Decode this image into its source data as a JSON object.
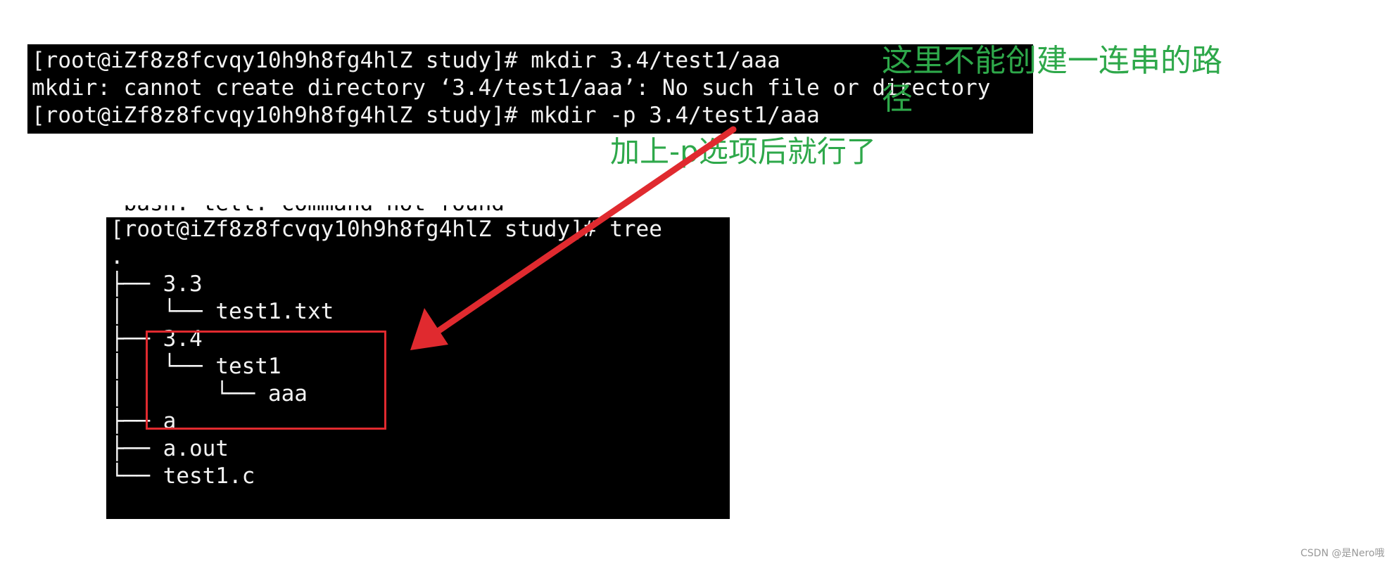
{
  "terminal_top": {
    "lines": [
      "[root@iZf8z8fcvqy10h9h8fg4hlZ study]# mkdir 3.4/test1/aaa",
      "mkdir: cannot create directory ‘3.4/test1/aaa’: No such file or directory",
      "[root@iZf8z8fcvqy10h9h8fg4hlZ study]# mkdir -p 3.4/test1/aaa"
    ]
  },
  "terminal_bottom": {
    "cut_line": "-bash: tell: command not found",
    "lines": [
      "[root@iZf8z8fcvqy10h9h8fg4hlZ study]# tree",
      ".",
      "├── 3.3",
      "│   └── test1.txt",
      "├── 3.4",
      "│   └── test1",
      "│       └── aaa",
      "├── a",
      "├── a.out",
      "└── test1.c"
    ]
  },
  "annotations": {
    "note1_line1": "这里不能创建一连串的路",
    "note1_line2": "径",
    "note2": "加上-p选项后就行了",
    "note_color": "#2ea84a",
    "highlight_color": "#e02a2f"
  },
  "watermark": "CSDN @是Nero哦"
}
